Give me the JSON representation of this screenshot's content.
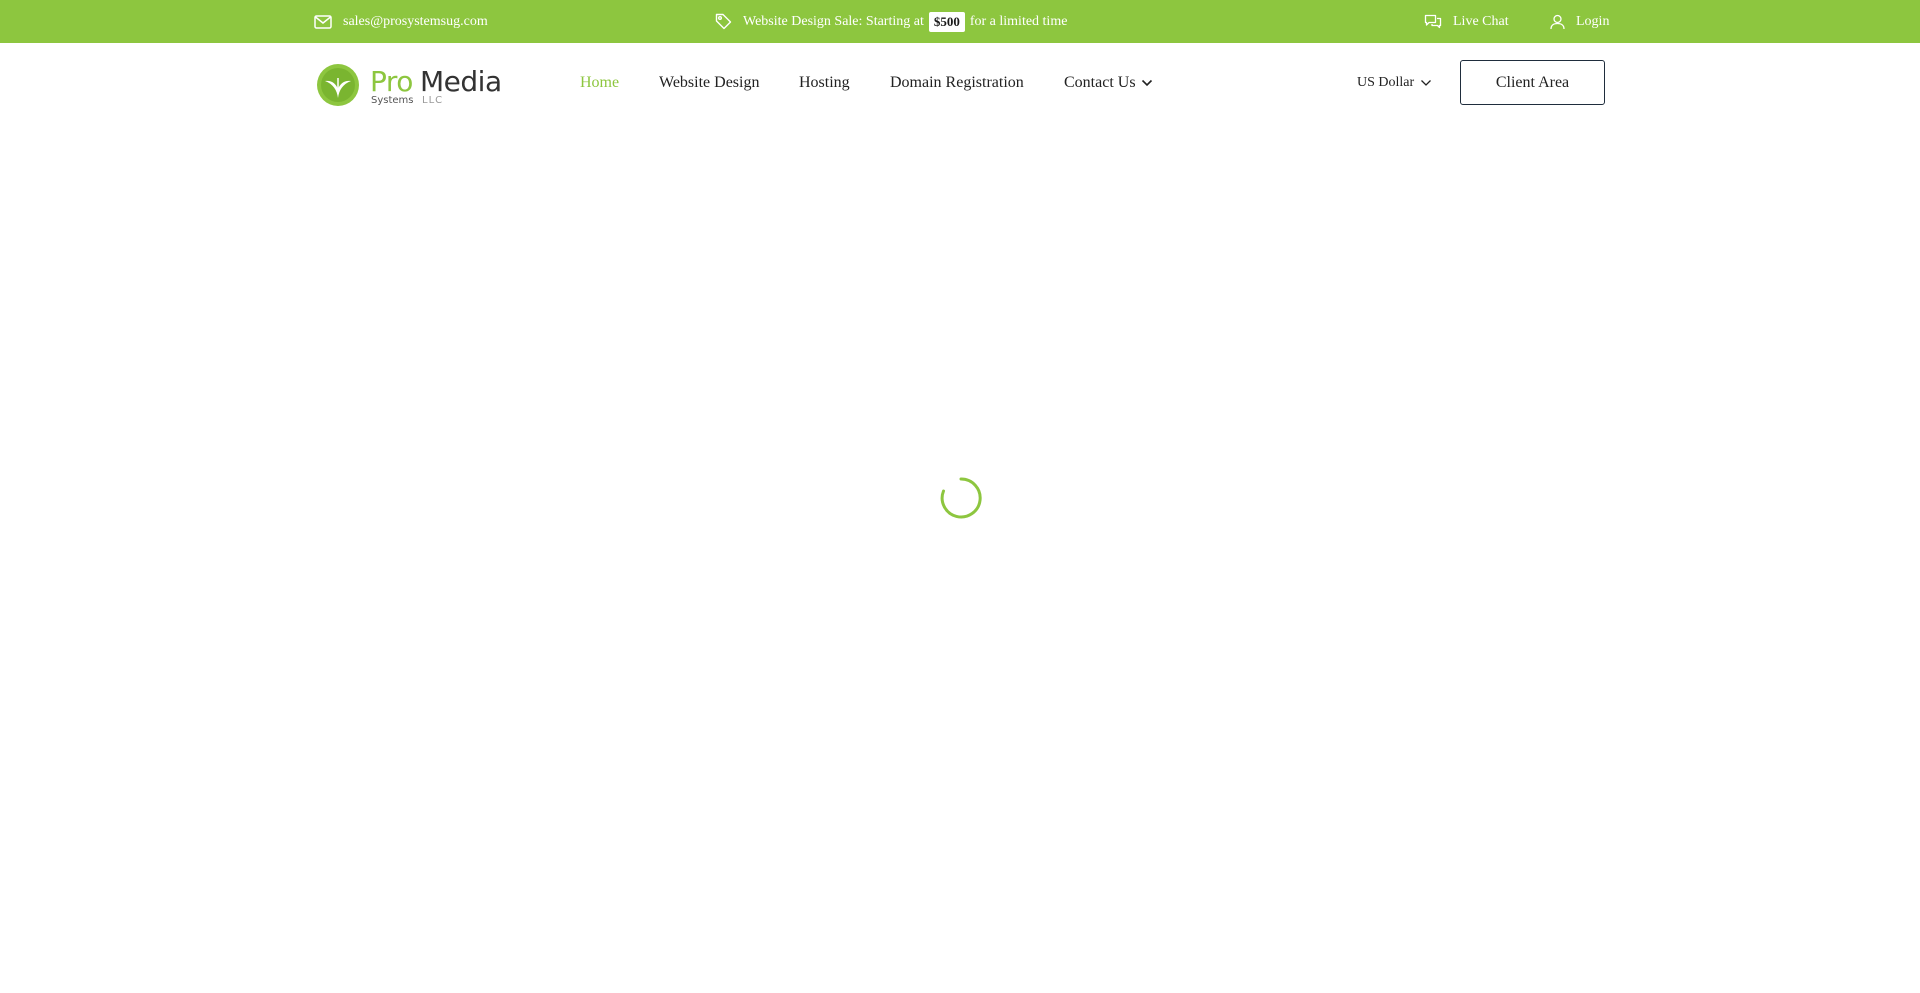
{
  "topbar": {
    "email": "sales@prosystemsug.com",
    "promo_text": "Website Design Sale: Starting at",
    "promo_price": "$500",
    "promo_suffix": "for a limited time",
    "live_chat": "Live Chat",
    "login": "Login"
  },
  "header": {
    "logo": {
      "word1": "Pro",
      "word2": "Media",
      "sub": "Systems",
      "llc": "LLC"
    },
    "nav": [
      {
        "label": "Home",
        "active": true
      },
      {
        "label": "Website Design"
      },
      {
        "label": "Hosting"
      },
      {
        "label": "Domain Registration"
      },
      {
        "label": "Contact Us",
        "has_dropdown": true
      }
    ],
    "currency": "US Dollar",
    "client_area": "Client Area"
  },
  "colors": {
    "accent": "#8dc63f",
    "text": "#222222",
    "button_border": "#1f2d3d"
  },
  "icons": {
    "email": "envelope-icon",
    "promo": "tag-icon",
    "chat": "chat-icon",
    "login": "user-icon",
    "dropdown": "chevron-down-icon",
    "loading": "loading-spinner-icon"
  }
}
